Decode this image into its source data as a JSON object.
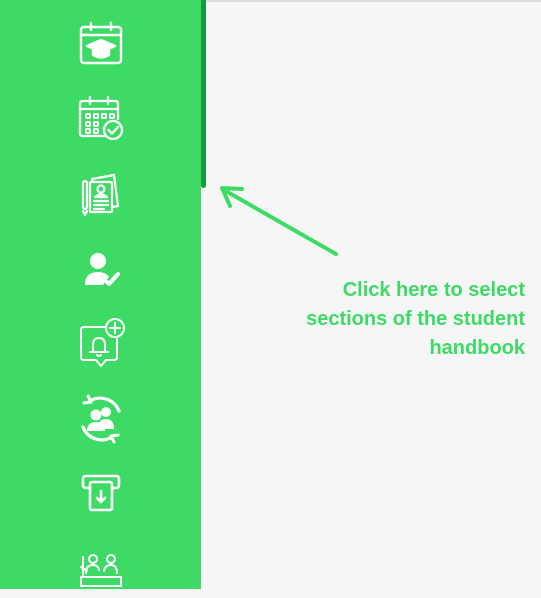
{
  "sidebar": {
    "items": [
      {
        "icon": "graduation-calendar-icon"
      },
      {
        "icon": "calendar-check-icon"
      },
      {
        "icon": "documents-icon"
      },
      {
        "icon": "user-check-icon"
      },
      {
        "icon": "notification-add-icon"
      },
      {
        "icon": "user-sync-icon"
      },
      {
        "icon": "download-card-icon"
      },
      {
        "icon": "group-meeting-icon"
      }
    ]
  },
  "hint": {
    "lines": [
      "Click here to select",
      "sections of the student",
      "handbook"
    ]
  },
  "colors": {
    "sidebar": "#3ddb66",
    "scroll_thumb": "#149c3c",
    "hint_text": "#3ddb66",
    "background": "#f6f6f6"
  }
}
